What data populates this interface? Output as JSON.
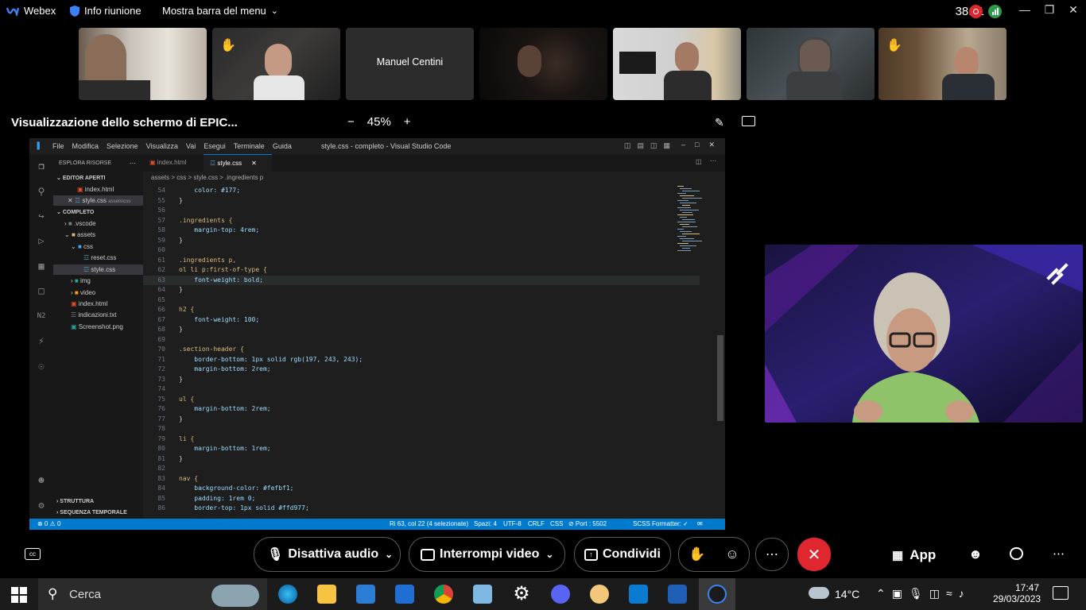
{
  "topbar": {
    "app_name": "Webex",
    "meeting_info": "Info riunione",
    "menu_toggle": "Mostra barra del menu",
    "timer": "38:11"
  },
  "participants": [
    {
      "name": "",
      "hand": false
    },
    {
      "name": "",
      "hand": true
    },
    {
      "name": "Manuel Centini",
      "hand": false
    },
    {
      "name": "",
      "hand": false
    },
    {
      "name": "",
      "hand": false
    },
    {
      "name": "",
      "hand": false
    },
    {
      "name": "",
      "hand": true
    }
  ],
  "share": {
    "title": "Visualizzazione dello schermo di EPIC...",
    "zoom": "45%",
    "zoom_minus": "−",
    "zoom_plus": "+"
  },
  "vscode": {
    "menu": [
      "File",
      "Modifica",
      "Selezione",
      "Visualizza",
      "Vai",
      "Esegui",
      "Terminale",
      "Guida"
    ],
    "window_title": "style.css - completo - Visual Studio Code",
    "sidebar": {
      "header": "ESPLORA RISORSE",
      "open_editors": "EDITOR APERTI",
      "open_files": [
        "index.html",
        "style.css"
      ],
      "open_file_path": "assets\\css",
      "project": "COMPLETO",
      "tree": [
        ".vscode",
        "assets",
        "css",
        "reset.css",
        "style.css",
        "img",
        "video",
        "index.html",
        "indicazioni.txt",
        "Screenshot.png"
      ],
      "outline": "STRUTTURA",
      "timeline": "SEQUENZA TEMPORALE"
    },
    "tabs": [
      "index.html",
      "style.css"
    ],
    "breadcrumb": "assets > css > style.css > .ingredients p",
    "code_lines": [
      {
        "n": "54",
        "t": "    color: #177;"
      },
      {
        "n": "55",
        "t": "}"
      },
      {
        "n": "56",
        "t": ""
      },
      {
        "n": "57",
        "t": ".ingredients {"
      },
      {
        "n": "58",
        "t": "    margin-top: 4rem;"
      },
      {
        "n": "59",
        "t": "}"
      },
      {
        "n": "60",
        "t": ""
      },
      {
        "n": "61",
        "t": ".ingredients p,"
      },
      {
        "n": "62",
        "t": "ol li p:first-of-type {"
      },
      {
        "n": "63",
        "t": "    font-weight: bold;"
      },
      {
        "n": "64",
        "t": "}"
      },
      {
        "n": "65",
        "t": ""
      },
      {
        "n": "66",
        "t": "h2 {"
      },
      {
        "n": "67",
        "t": "    font-weight: 100;"
      },
      {
        "n": "68",
        "t": "}"
      },
      {
        "n": "69",
        "t": ""
      },
      {
        "n": "70",
        "t": ".section-header {"
      },
      {
        "n": "71",
        "t": "    border-bottom: 1px solid rgb(197, 243, 243);"
      },
      {
        "n": "72",
        "t": "    margin-bottom: 2rem;"
      },
      {
        "n": "73",
        "t": "}"
      },
      {
        "n": "74",
        "t": ""
      },
      {
        "n": "75",
        "t": "ul {"
      },
      {
        "n": "76",
        "t": "    margin-bottom: 2rem;"
      },
      {
        "n": "77",
        "t": "}"
      },
      {
        "n": "78",
        "t": ""
      },
      {
        "n": "79",
        "t": "li {"
      },
      {
        "n": "80",
        "t": "    margin-bottom: 1rem;"
      },
      {
        "n": "81",
        "t": "}"
      },
      {
        "n": "82",
        "t": ""
      },
      {
        "n": "83",
        "t": "nav {"
      },
      {
        "n": "84",
        "t": "    background-color: #fefbf1;"
      },
      {
        "n": "85",
        "t": "    padding: 1rem 0;"
      },
      {
        "n": "86",
        "t": "    border-top: 1px solid #ffd977;"
      }
    ],
    "status": {
      "problems": "⊗ 0 ⚠ 0",
      "position": "Ri 63, col 22 (4 selezionate)",
      "spaces": "Spazi: 4",
      "encoding": "UTF-8",
      "eol": "CRLF",
      "language": "CSS",
      "port": "⊘ Port : 5502",
      "formatter": "SCSS Formatter: ✓"
    }
  },
  "controls": {
    "mute": "Disattiva audio",
    "video": "Interrompi video",
    "share": "Condividi",
    "apps": "App"
  },
  "taskbar": {
    "search": "Cerca",
    "weather": "14°C",
    "time": "17:47",
    "date": "29/03/2023"
  },
  "colors": {
    "accent_blue": "#007acc",
    "leave_red": "#e0262f",
    "webex_blue": "#3a83f7"
  }
}
